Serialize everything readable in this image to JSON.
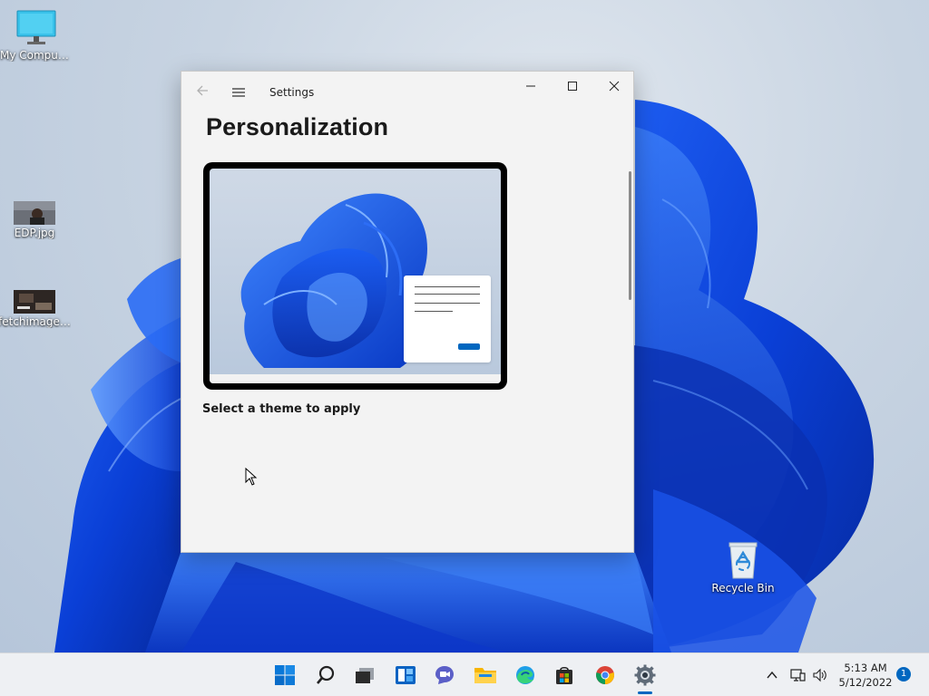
{
  "desktop": {
    "icons": [
      {
        "label": "My Computer",
        "icon": "monitor-icon"
      },
      {
        "label": "EDP.jpg",
        "icon": "image-thumbnail-icon"
      },
      {
        "label": "fetchimage....",
        "icon": "image-thumbnail-icon"
      },
      {
        "label": "Recycle Bin",
        "icon": "recycle-bin-icon"
      }
    ]
  },
  "window": {
    "app_title": "Settings",
    "page_heading": "Personalization",
    "section_label": "Select a theme to apply",
    "controls": {
      "back": "back-arrow-icon",
      "menu": "hamburger-menu-icon",
      "minimize": "minimize-icon",
      "maximize": "maximize-icon",
      "close": "close-icon"
    },
    "accent_color": "#0067c0"
  },
  "taskbar": {
    "apps": [
      {
        "name": "start",
        "icon": "windows-start-icon"
      },
      {
        "name": "search",
        "icon": "search-icon"
      },
      {
        "name": "task-view",
        "icon": "task-view-icon"
      },
      {
        "name": "widgets",
        "icon": "widgets-icon"
      },
      {
        "name": "chat",
        "icon": "teams-chat-icon"
      },
      {
        "name": "file-explorer",
        "icon": "folder-icon"
      },
      {
        "name": "edge",
        "icon": "edge-browser-icon"
      },
      {
        "name": "store",
        "icon": "store-icon"
      },
      {
        "name": "chrome",
        "icon": "chrome-browser-icon"
      },
      {
        "name": "settings",
        "icon": "gear-icon",
        "active": true
      }
    ],
    "tray": {
      "icons": [
        "chevron-up-icon",
        "network-icon",
        "volume-icon"
      ],
      "time": "5:13 AM",
      "date": "5/12/2022",
      "notifications": "1"
    }
  }
}
